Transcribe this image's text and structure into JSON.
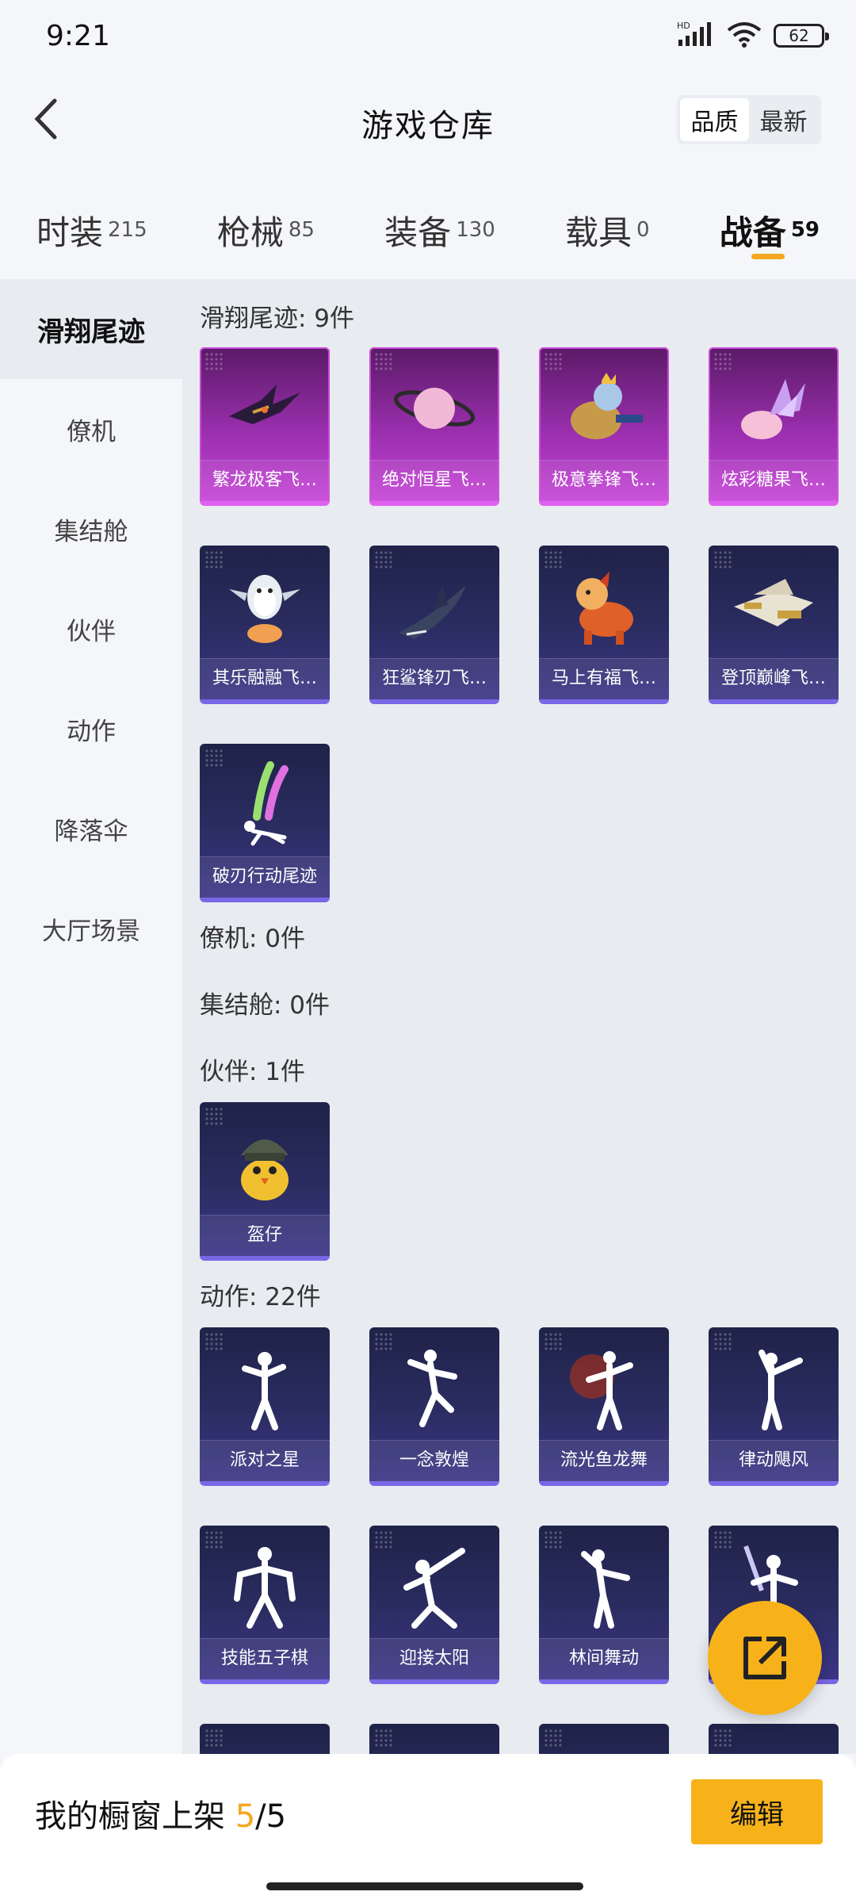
{
  "status": {
    "time": "9:21",
    "network": "HD",
    "battery": "62"
  },
  "header": {
    "title": "游戏仓库",
    "sort": [
      "品质",
      "最新"
    ]
  },
  "category_tabs": [
    {
      "label": "时装",
      "count": "215"
    },
    {
      "label": "枪械",
      "count": "85"
    },
    {
      "label": "装备",
      "count": "130"
    },
    {
      "label": "载具",
      "count": "0"
    },
    {
      "label": "战备",
      "count": "59"
    }
  ],
  "side_nav": [
    "滑翔尾迹",
    "僚机",
    "集结舱",
    "伙伴",
    "动作",
    "降落伞",
    "大厅场景"
  ],
  "sections": {
    "glide": {
      "title": "滑翔尾迹: 9件",
      "items": [
        "繁龙极客飞…",
        "绝对恒星飞…",
        "极意拳锋飞…",
        "炫彩糖果飞…",
        "其乐融融飞…",
        "狂鲨锋刃飞…",
        "马上有福飞…",
        "登顶巅峰飞…",
        "破刃行动尾迹"
      ]
    },
    "wingman": {
      "title": "僚机: 0件"
    },
    "capsule": {
      "title": "集结舱: 0件"
    },
    "partner": {
      "title": "伙伴: 1件",
      "items": [
        "盔仔"
      ]
    },
    "emote": {
      "title": "动作: 22件",
      "items": [
        "派对之星",
        "一念敦煌",
        "流光鱼龙舞",
        "律动飓风",
        "技能五子棋",
        "迎接太阳",
        "林间舞动"
      ]
    }
  },
  "bottom": {
    "shelf_label": "我的橱窗上架",
    "shelf_current": "5",
    "shelf_total": "/5",
    "edit": "编辑"
  },
  "colors": {
    "accent": "#f5a623",
    "purple_card": "#c544d6",
    "dark_card": "#2b2d62"
  }
}
